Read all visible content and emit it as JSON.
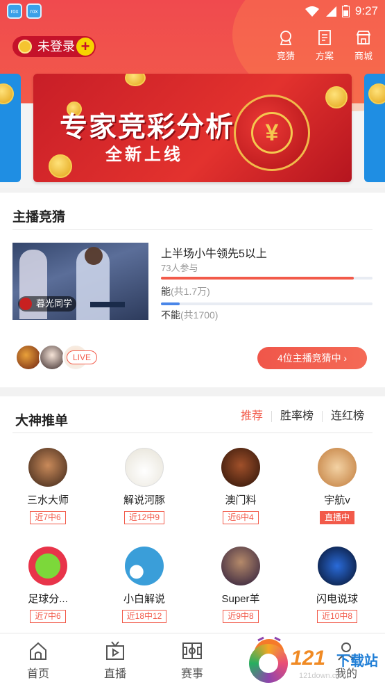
{
  "status_bar": {
    "time": "9:27",
    "app_icon_text": "rox"
  },
  "header": {
    "login_label": "未登录",
    "plus_symbol": "+",
    "nav": [
      {
        "id": "guess",
        "label": "竞猜",
        "icon": "trophy-icon"
      },
      {
        "id": "plan",
        "label": "方案",
        "icon": "document-icon"
      },
      {
        "id": "shop",
        "label": "商城",
        "icon": "store-icon"
      }
    ]
  },
  "banner": {
    "title": "专家竞彩分析",
    "subtitle": "全新上线",
    "symbol": "¥"
  },
  "anchor_guess": {
    "title": "主播竞猜",
    "video_tag": "暮光同学",
    "question": "上半场小牛领先5以上",
    "participants": "73人参与",
    "options": [
      {
        "label": "能",
        "count": "(共1.7万)",
        "ratio": 0.91,
        "color": "#f25a4a"
      },
      {
        "label": "不能",
        "count": "(共1700)",
        "ratio": 0.09,
        "color": "#4a86e8"
      }
    ],
    "live_label": "LIVE",
    "cta_label": "4位主播竞猜中 ›"
  },
  "experts": {
    "title": "大神推单",
    "tabs": [
      {
        "label": "推荐",
        "active": true
      },
      {
        "label": "胜率榜",
        "active": false
      },
      {
        "label": "连红榜",
        "active": false
      }
    ],
    "rows": [
      [
        {
          "name": "三水大师",
          "record": "近7中6",
          "live": false,
          "color": "#5a3a2a"
        },
        {
          "name": "解说河豚",
          "record": "近12中9",
          "live": false,
          "color": "#f0efe8"
        },
        {
          "name": "澳门料",
          "record": "近6中4",
          "live": false,
          "color": "#6b2e1a"
        },
        {
          "name": "宇航v",
          "record": "直播中",
          "live": true,
          "color": "#d9a36a"
        }
      ],
      [
        {
          "name": "足球分...",
          "record": "近7中6",
          "live": false,
          "color": "#e8344a"
        },
        {
          "name": "小白解说",
          "record": "近18中12",
          "live": false,
          "color": "#3a9ed9"
        },
        {
          "name": "Super羊",
          "record": "近9中8",
          "live": false,
          "color": "#3a2a4a"
        },
        {
          "name": "闪电说球",
          "record": "近10中8",
          "live": false,
          "color": "#0a1a3a"
        }
      ]
    ]
  },
  "bottom_nav": [
    {
      "label": "首页",
      "icon": "home-icon"
    },
    {
      "label": "直播",
      "icon": "tv-icon"
    },
    {
      "label": "赛事",
      "icon": "field-icon"
    },
    {
      "label": "",
      "icon": "center-guess-icon"
    },
    {
      "label": "我的",
      "icon": "profile-icon"
    }
  ],
  "watermark": {
    "brand": "121",
    "brand_suffix": "下载站",
    "url": "121down.com"
  }
}
